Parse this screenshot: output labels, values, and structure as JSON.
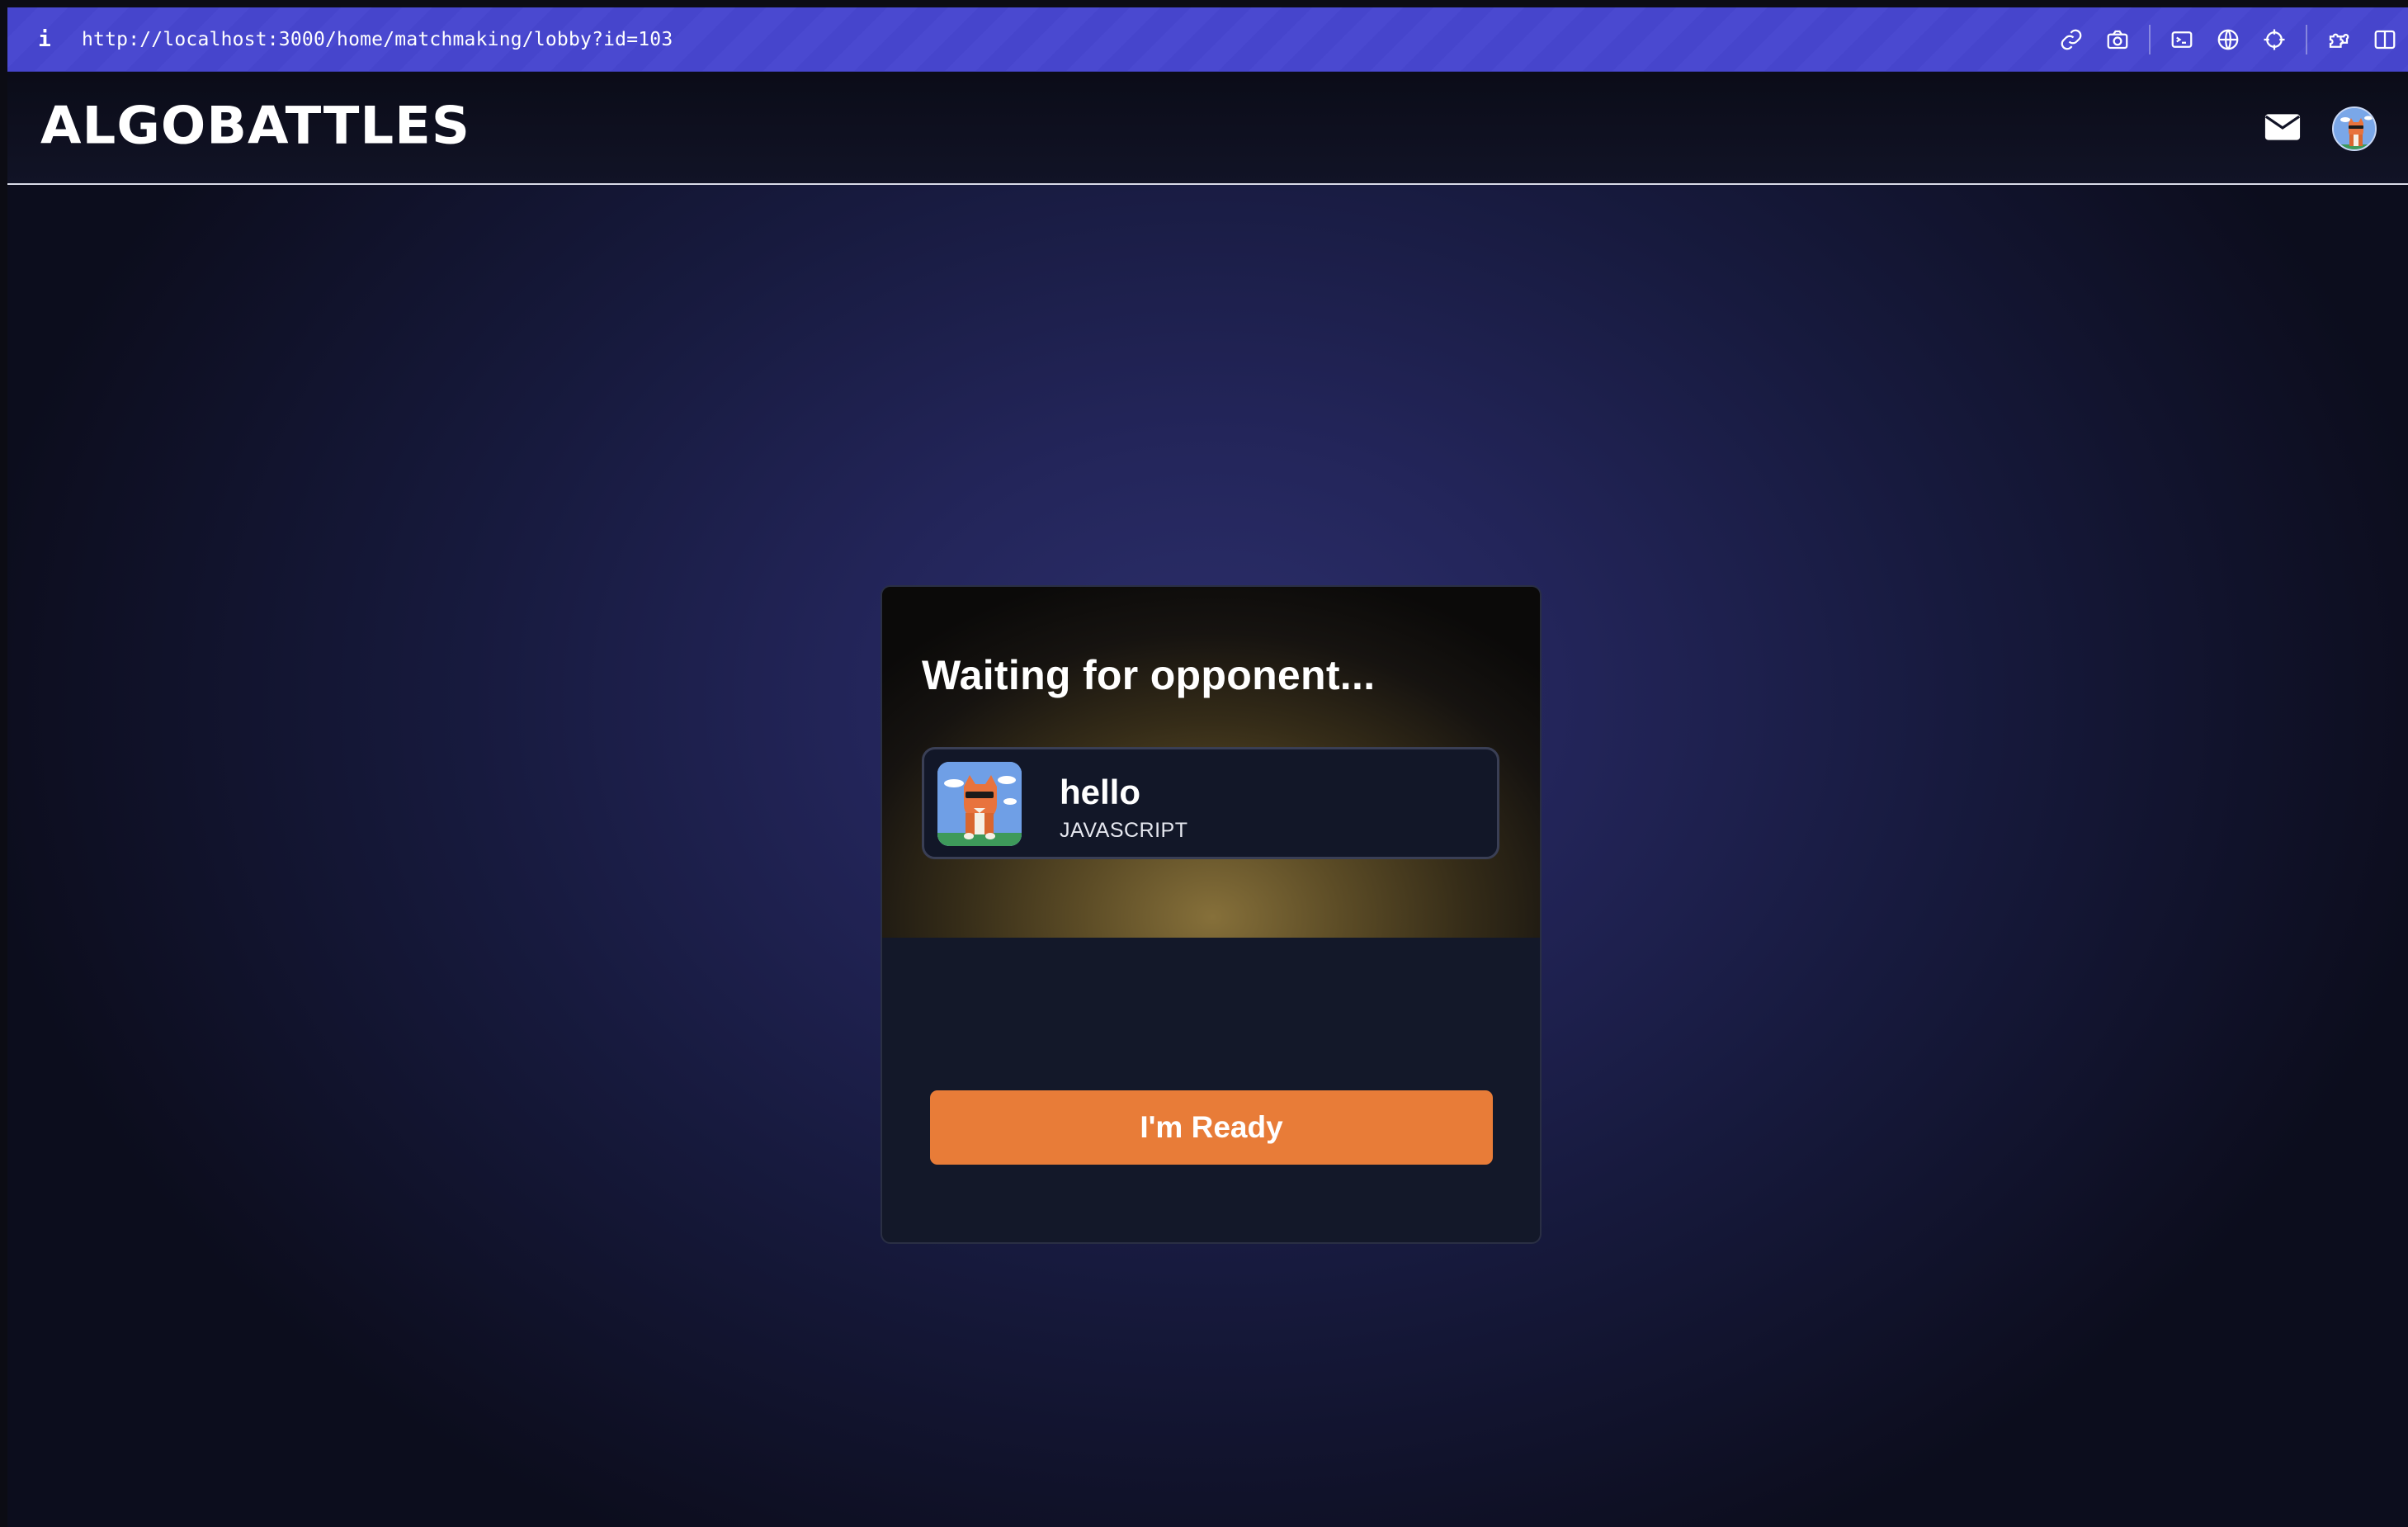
{
  "browser": {
    "info_glyph": "i",
    "url": "http://localhost:3000/home/matchmaking/lobby?id=103",
    "toolbar_icons": [
      "link-icon",
      "camera-icon",
      "terminal-icon",
      "globe-icon",
      "crosshair-icon",
      "extension-icon",
      "sidebar-icon"
    ]
  },
  "header": {
    "logo": "ALGOBATTLES",
    "icons": [
      "mail-icon",
      "profile-avatar"
    ]
  },
  "lobby": {
    "title": "Waiting for opponent...",
    "player": {
      "name": "hello",
      "language": "JAVASCRIPT"
    },
    "ready_button": "I'm Ready"
  },
  "colors": {
    "browser_bar": "#4645cc",
    "accent_button": "#e87c38",
    "card_bg": "#131829",
    "page_glow": "#2c2f6b"
  }
}
